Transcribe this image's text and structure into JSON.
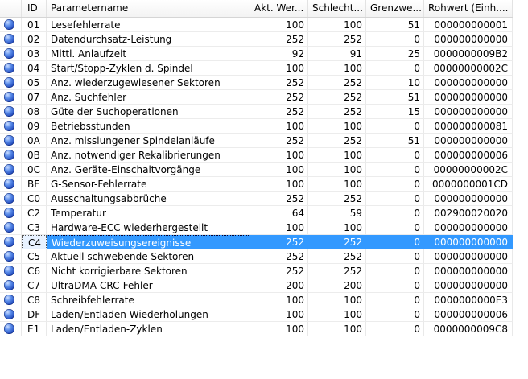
{
  "headers": {
    "id": "ID",
    "name": "Parametername",
    "akt": "Akt. Wer...",
    "schlecht": "Schlecht...",
    "grenz": "Grenzwe...",
    "roh": "Rohwert (Einh...."
  },
  "colors": {
    "selected_row": "#3399ff",
    "orb": "#2050c8"
  },
  "row_icon": "blue-orb-icon",
  "selected_row_id": "C4",
  "rows": [
    {
      "id": "01",
      "name": "Lesefehlerrate",
      "akt": "100",
      "schlecht": "100",
      "grenz": "51",
      "roh": "000000000001"
    },
    {
      "id": "02",
      "name": "Datendurchsatz-Leistung",
      "akt": "252",
      "schlecht": "252",
      "grenz": "0",
      "roh": "000000000000"
    },
    {
      "id": "03",
      "name": "Mittl. Anlaufzeit",
      "akt": "92",
      "schlecht": "91",
      "grenz": "25",
      "roh": "0000000009B2"
    },
    {
      "id": "04",
      "name": "Start/Stopp-Zyklen d. Spindel",
      "akt": "100",
      "schlecht": "100",
      "grenz": "0",
      "roh": "00000000002C"
    },
    {
      "id": "05",
      "name": "Anz. wiederzugewiesener Sektoren",
      "akt": "252",
      "schlecht": "252",
      "grenz": "10",
      "roh": "000000000000"
    },
    {
      "id": "07",
      "name": "Anz. Suchfehler",
      "akt": "252",
      "schlecht": "252",
      "grenz": "51",
      "roh": "000000000000"
    },
    {
      "id": "08",
      "name": "Güte der Suchoperationen",
      "akt": "252",
      "schlecht": "252",
      "grenz": "15",
      "roh": "000000000000"
    },
    {
      "id": "09",
      "name": "Betriebsstunden",
      "akt": "100",
      "schlecht": "100",
      "grenz": "0",
      "roh": "000000000081"
    },
    {
      "id": "0A",
      "name": "Anz. misslungener Spindelanläufe",
      "akt": "252",
      "schlecht": "252",
      "grenz": "51",
      "roh": "000000000000"
    },
    {
      "id": "0B",
      "name": "Anz. notwendiger Rekalibrierungen",
      "akt": "100",
      "schlecht": "100",
      "grenz": "0",
      "roh": "000000000006"
    },
    {
      "id": "0C",
      "name": "Anz. Geräte-Einschaltvorgänge",
      "akt": "100",
      "schlecht": "100",
      "grenz": "0",
      "roh": "00000000002C"
    },
    {
      "id": "BF",
      "name": "G-Sensor-Fehlerrate",
      "akt": "100",
      "schlecht": "100",
      "grenz": "0",
      "roh": "0000000001CD"
    },
    {
      "id": "C0",
      "name": "Ausschaltungsabbrüche",
      "akt": "252",
      "schlecht": "252",
      "grenz": "0",
      "roh": "000000000000"
    },
    {
      "id": "C2",
      "name": "Temperatur",
      "akt": "64",
      "schlecht": "59",
      "grenz": "0",
      "roh": "002900020020"
    },
    {
      "id": "C3",
      "name": "Hardware-ECC wiederhergestellt",
      "akt": "100",
      "schlecht": "100",
      "grenz": "0",
      "roh": "000000000000"
    },
    {
      "id": "C4",
      "name": "Wiederzuweisungsereignisse",
      "akt": "252",
      "schlecht": "252",
      "grenz": "0",
      "roh": "000000000000"
    },
    {
      "id": "C5",
      "name": "Aktuell schwebende Sektoren",
      "akt": "252",
      "schlecht": "252",
      "grenz": "0",
      "roh": "000000000000"
    },
    {
      "id": "C6",
      "name": "Nicht korrigierbare Sektoren",
      "akt": "252",
      "schlecht": "252",
      "grenz": "0",
      "roh": "000000000000"
    },
    {
      "id": "C7",
      "name": "UltraDMA-CRC-Fehler",
      "akt": "200",
      "schlecht": "200",
      "grenz": "0",
      "roh": "000000000000"
    },
    {
      "id": "C8",
      "name": "Schreibfehlerrate",
      "akt": "100",
      "schlecht": "100",
      "grenz": "0",
      "roh": "0000000000E3"
    },
    {
      "id": "DF",
      "name": "Laden/Entladen-Wiederholungen",
      "akt": "100",
      "schlecht": "100",
      "grenz": "0",
      "roh": "000000000006"
    },
    {
      "id": "E1",
      "name": "Laden/Entladen-Zyklen",
      "akt": "100",
      "schlecht": "100",
      "grenz": "0",
      "roh": "0000000009C8"
    }
  ]
}
